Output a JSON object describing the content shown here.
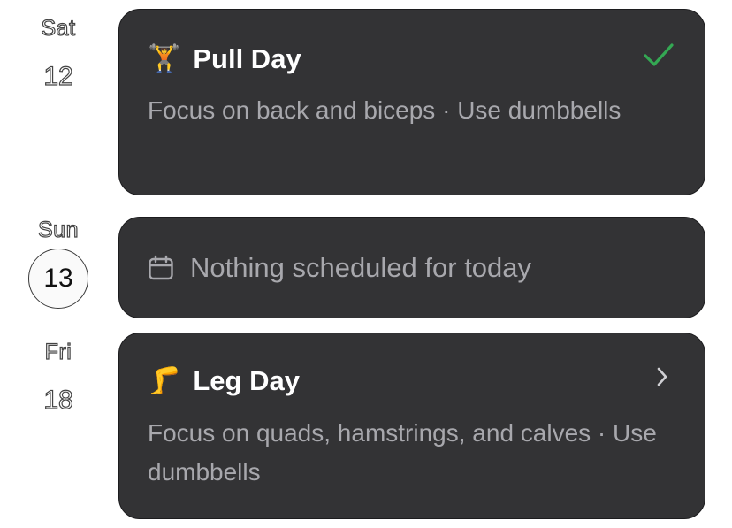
{
  "days": [
    {
      "weekday": "Sat",
      "day": "12",
      "is_today": false,
      "card": {
        "type": "workout",
        "emoji": "🏋️",
        "title": "Pull Day",
        "description": "Focus on back and biceps · Use dumbbells",
        "status_icon": "checkmark-icon",
        "completed": true
      }
    },
    {
      "weekday": "Sun",
      "day": "13",
      "is_today": true,
      "card": {
        "type": "empty",
        "icon": "calendar-icon",
        "text": "Nothing scheduled for today"
      }
    },
    {
      "weekday": "Fri",
      "day": "18",
      "is_today": false,
      "card": {
        "type": "workout",
        "emoji": "🦵",
        "title": "Leg Day",
        "description": "Focus on quads, hamstrings, and calves · Use dumbbells",
        "status_icon": "chevron-right-icon",
        "completed": false
      }
    }
  ],
  "colors": {
    "card_bg": "#333335",
    "title": "#ffffff",
    "muted": "#a8a8ad",
    "check": "#34a853"
  }
}
